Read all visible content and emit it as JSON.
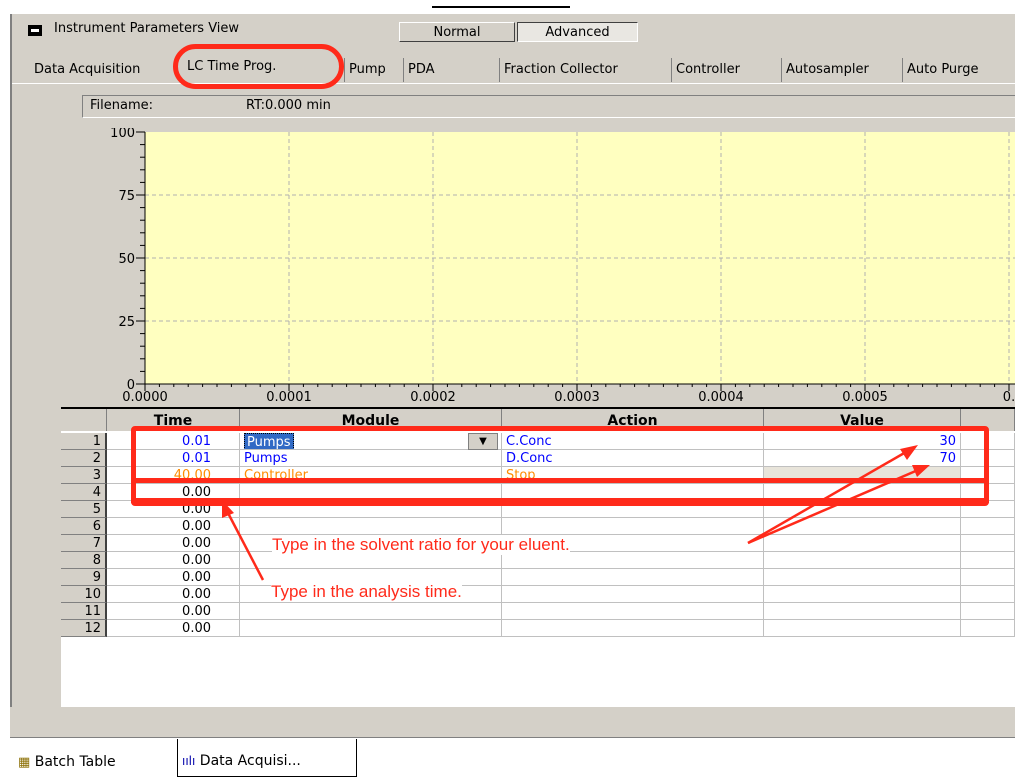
{
  "top": {
    "partial_label": ""
  },
  "view": {
    "title": "Instrument Parameters View"
  },
  "modes": {
    "normal": "Normal",
    "advanced": "Advanced"
  },
  "tabs": [
    "Data Acquisition",
    "LC Time Prog.",
    "Pump",
    "PDA",
    "Fraction Collector",
    "Controller",
    "Autosampler",
    "Auto Purge"
  ],
  "file": {
    "label": "Filename:",
    "rt": "RT:0.000 min"
  },
  "chart_data": {
    "type": "line",
    "series": [],
    "ylim": [
      0,
      100
    ],
    "xlim": [
      0,
      0.0006
    ],
    "y_ticks": [
      "100",
      "75",
      "50",
      "25",
      "0"
    ],
    "x_ticks": [
      "0.0000",
      "0.0001",
      "0.0002",
      "0.0003",
      "0.0004",
      "0.0005",
      "0."
    ],
    "background": "#ffffc0",
    "grid": true
  },
  "table": {
    "headers": {
      "time": "Time",
      "module": "Module",
      "action": "Action",
      "value": "Value"
    },
    "rows": [
      {
        "n": "1",
        "time": "0.01",
        "module": "Pumps",
        "action": "C.Conc",
        "value": "30"
      },
      {
        "n": "2",
        "time": "0.01",
        "module": "Pumps",
        "action": "D.Conc",
        "value": "70"
      },
      {
        "n": "3",
        "time": "40.00",
        "module": "Controller",
        "action": "Stop",
        "value": ""
      },
      {
        "n": "4",
        "time": "0.00",
        "module": "",
        "action": "",
        "value": ""
      },
      {
        "n": "5",
        "time": "0.00",
        "module": "",
        "action": "",
        "value": ""
      },
      {
        "n": "6",
        "time": "0.00",
        "module": "",
        "action": "",
        "value": ""
      },
      {
        "n": "7",
        "time": "0.00",
        "module": "",
        "action": "",
        "value": ""
      },
      {
        "n": "8",
        "time": "0.00",
        "module": "",
        "action": "",
        "value": ""
      },
      {
        "n": "9",
        "time": "0.00",
        "module": "",
        "action": "",
        "value": ""
      },
      {
        "n": "10",
        "time": "0.00",
        "module": "",
        "action": "",
        "value": ""
      },
      {
        "n": "11",
        "time": "0.00",
        "module": "",
        "action": "",
        "value": ""
      },
      {
        "n": "12",
        "time": "0.00",
        "module": "",
        "action": "",
        "value": ""
      }
    ]
  },
  "notes": {
    "solvent": "Type in the solvent ratio for your eluent.",
    "time": "Type in the analysis time."
  },
  "bottom_tabs": {
    "batch": "Batch Table",
    "acq": "Data Acquisi..."
  },
  "colors": {
    "annotation": "#ff2a1a",
    "program_blue": "#0000ff",
    "stop_orange": "#ff8c00",
    "plot_bg": "#ffffc0"
  }
}
